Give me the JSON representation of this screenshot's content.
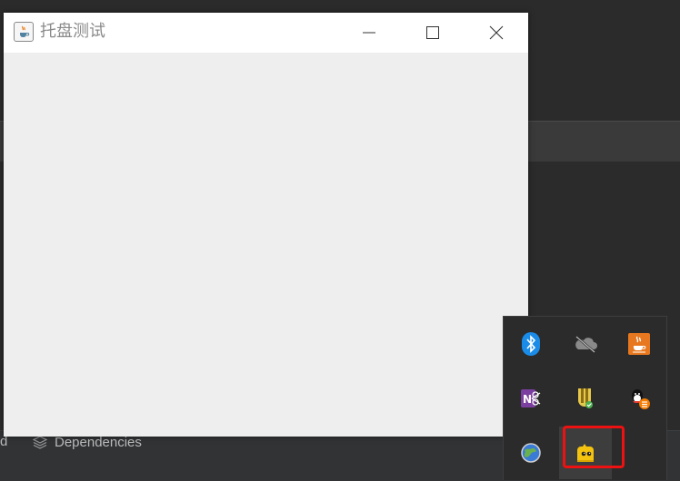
{
  "window": {
    "title": "托盘测试",
    "minimize": "minimize",
    "maximize": "maximize",
    "close": "close"
  },
  "ide": {
    "bottom_left_fragment": "d",
    "dependencies_tab": "Dependencies"
  },
  "tray": {
    "icons": [
      {
        "name": "bluetooth-icon"
      },
      {
        "name": "onedrive-offline-icon"
      },
      {
        "name": "java-icon"
      },
      {
        "name": "onenote-clipper-icon"
      },
      {
        "name": "security-shield-icon"
      },
      {
        "name": "qq-icon"
      },
      {
        "name": "globe-icon"
      },
      {
        "name": "yellow-app-tray-icon"
      }
    ],
    "accent_highlight": "#ee1111"
  }
}
